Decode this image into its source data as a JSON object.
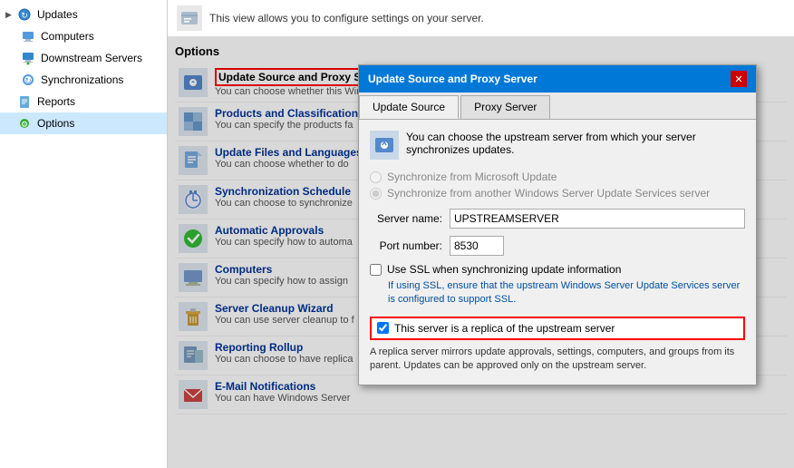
{
  "sidebar": {
    "items": [
      {
        "id": "updates",
        "label": "Updates",
        "icon": "updates-icon",
        "arrow": "▶",
        "indent": 0
      },
      {
        "id": "computers",
        "label": "Computers",
        "icon": "computers-icon",
        "arrow": "",
        "indent": 1
      },
      {
        "id": "downstream-servers",
        "label": "Downstream Servers",
        "icon": "downstream-icon",
        "arrow": "",
        "indent": 1
      },
      {
        "id": "synchronizations",
        "label": "Synchronizations",
        "icon": "sync-icon",
        "arrow": "",
        "indent": 1
      },
      {
        "id": "reports",
        "label": "Reports",
        "icon": "reports-icon",
        "arrow": "",
        "indent": 0
      },
      {
        "id": "options",
        "label": "Options",
        "icon": "options-icon",
        "arrow": "",
        "indent": 0,
        "selected": true
      }
    ]
  },
  "infobar": {
    "text": "This view allows you to configure settings on your server."
  },
  "options_section": {
    "title": "Options",
    "items": [
      {
        "id": "update-source",
        "title": "Update Source and Proxy Server",
        "desc": "You can choose whether this Windows Server Update Services server synchronizes from Microsoft Update or from an up",
        "highlighted": true
      },
      {
        "id": "products-classifications",
        "title": "Products and Classifications",
        "desc": "You can specify the products fa"
      },
      {
        "id": "update-files",
        "title": "Update Files and Languages",
        "desc": "You can choose whether to do"
      },
      {
        "id": "sync-schedule",
        "title": "Synchronization Schedule",
        "desc": "You can choose to synchronize"
      },
      {
        "id": "auto-approvals",
        "title": "Automatic Approvals",
        "desc": "You can specify how to automa"
      },
      {
        "id": "computers",
        "title": "Computers",
        "desc": "You can specify how to assign"
      },
      {
        "id": "cleanup-wizard",
        "title": "Server Cleanup Wizard",
        "desc": "You can use server cleanup to f"
      },
      {
        "id": "reporting-rollup",
        "title": "Reporting Rollup",
        "desc": "You can choose to have replica"
      },
      {
        "id": "email-notifications",
        "title": "E-Mail Notifications",
        "desc": "You can have Windows Server"
      }
    ]
  },
  "modal": {
    "title": "Update Source and Proxy Server",
    "close_label": "✕",
    "tabs": [
      {
        "id": "update-source",
        "label": "Update Source",
        "active": true
      },
      {
        "id": "proxy-server",
        "label": "Proxy Server",
        "active": false
      }
    ],
    "desc_text": "You can choose the upstream server from which your server synchronizes updates.",
    "radio1": {
      "label": "Synchronize from Microsoft Update",
      "value": "microsoft",
      "disabled": true
    },
    "radio2": {
      "label": "Synchronize from another Windows Server Update Services server",
      "value": "other",
      "checked": true,
      "disabled": true
    },
    "server_name_label": "Server name:",
    "server_name_value": "UPSTREAMSERVER",
    "port_label": "Port number:",
    "port_value": "8530",
    "ssl_label": "Use SSL when synchronizing update information",
    "ssl_checked": false,
    "ssl_note": "If using SSL, ensure that the upstream Windows Server Update Services server is configured to support SSL.",
    "replica_label": "This server is a replica of the upstream server",
    "replica_checked": true,
    "replica_note": "A replica server mirrors update approvals, settings, computers, and groups from its parent. Updates can be approved only on the upstream server."
  }
}
